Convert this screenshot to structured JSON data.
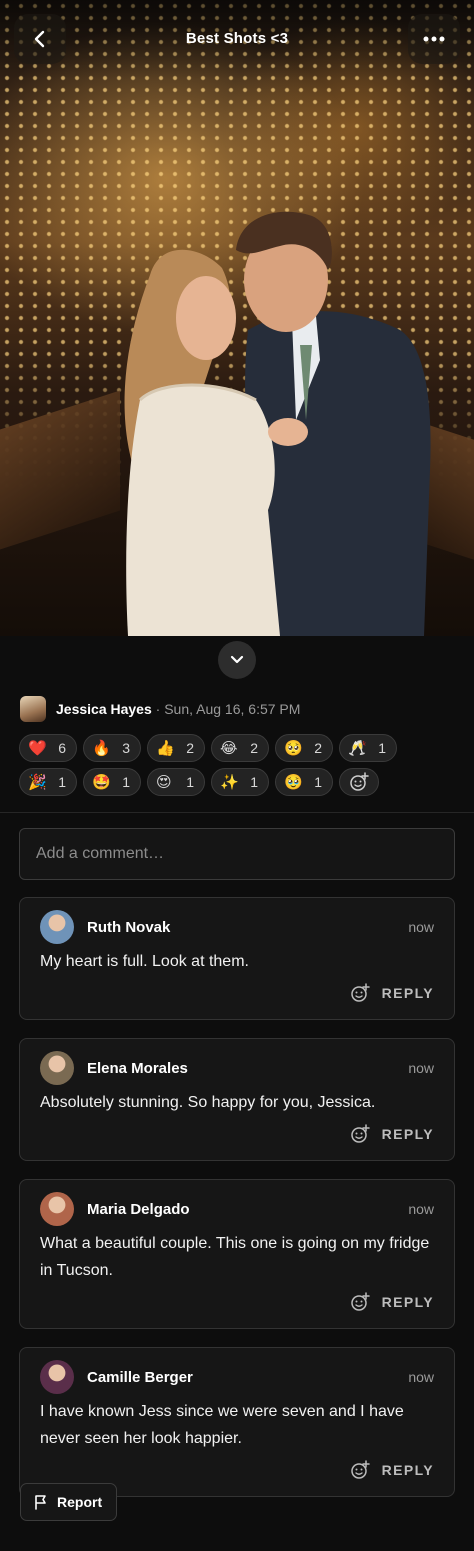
{
  "header": {
    "title": "Best Shots <3",
    "back_icon": "chevron-left-icon",
    "more_icon": "more-horizontal-icon"
  },
  "post": {
    "author_name": "Jessica Hayes",
    "date": "· Sun, Aug 16, 6:57 PM"
  },
  "reactions": [
    {
      "emoji": "❤️",
      "count": "6",
      "name": "heart"
    },
    {
      "emoji": "🔥",
      "count": "3",
      "name": "fire"
    },
    {
      "emoji": "👍",
      "count": "2",
      "name": "thumbs-up"
    },
    {
      "emoji": "😂",
      "count": "2",
      "name": "laughing"
    },
    {
      "emoji": "🥺",
      "count": "2",
      "name": "pleading"
    },
    {
      "emoji": "🥂",
      "count": "1",
      "name": "champagne"
    },
    {
      "emoji": "🎉",
      "count": "1",
      "name": "party"
    },
    {
      "emoji": "🤩",
      "count": "1",
      "name": "star-struck"
    },
    {
      "emoji": "😍",
      "count": "1",
      "name": "heart-eyes"
    },
    {
      "emoji": "✨",
      "count": "1",
      "name": "sparkles"
    },
    {
      "emoji": "🥹",
      "count": "1",
      "name": "holding-tears"
    }
  ],
  "comment_box": {
    "placeholder": "Add a comment…"
  },
  "comments": [
    {
      "name": "Ruth Novak",
      "time": "now",
      "text": "My heart is full. Look at them.",
      "reply": "REPLY",
      "avatar_color": "#6f93b8"
    },
    {
      "name": "Elena Morales",
      "time": "now",
      "text": "Absolutely stunning. So happy for you, Jessica.",
      "reply": "REPLY",
      "avatar_color": "#7a6a52"
    },
    {
      "name": "Maria Delgado",
      "time": "now",
      "text": "What a beautiful couple. This one is going on my fridge in Tucson.",
      "reply": "REPLY",
      "avatar_color": "#b0654a"
    },
    {
      "name": "Camille Berger",
      "time": "now",
      "text": "I have known Jess since we were seven and I have never seen her look happier.",
      "reply": "REPLY",
      "avatar_color": "#5a2e4a"
    }
  ],
  "footer": {
    "report_label": "Report"
  }
}
